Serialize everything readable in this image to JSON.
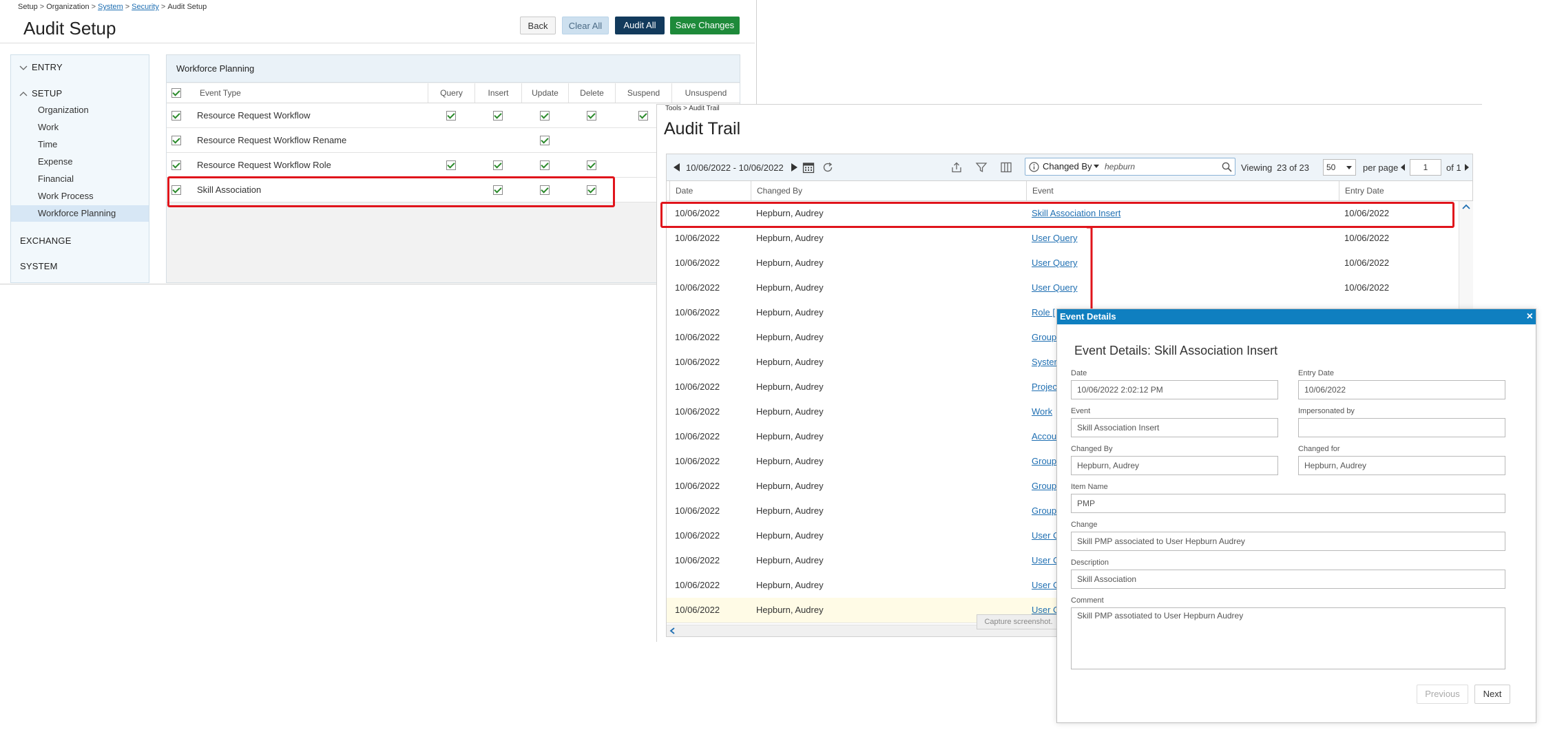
{
  "audit_setup": {
    "breadcrumb": {
      "setup": "Setup",
      "organization": "Organization",
      "system": "System",
      "security": "Security",
      "current": "Audit Setup",
      "sep": ">"
    },
    "title": "Audit Setup",
    "buttons": {
      "back": "Back",
      "clear_all": "Clear All",
      "audit_all": "Audit All",
      "save_changes": "Save Changes"
    },
    "nav": {
      "entry": "ENTRY",
      "setup": "SETUP",
      "setup_items": [
        "Organization",
        "Work",
        "Time",
        "Expense",
        "Financial",
        "Work Process",
        "Workforce Planning"
      ],
      "exchange": "EXCHANGE",
      "system": "SYSTEM"
    },
    "panel_title": "Workforce Planning",
    "columns": [
      "Event Type",
      "Query",
      "Insert",
      "Update",
      "Delete",
      "Suspend",
      "Unsuspend"
    ],
    "rows": [
      {
        "event": "Resource Request Workflow",
        "query": true,
        "insert": true,
        "update": true,
        "delete": true,
        "suspend": true
      },
      {
        "event": "Resource Request Workflow Rename",
        "query": false,
        "insert": false,
        "update": true,
        "delete": false,
        "suspend": false
      },
      {
        "event": "Resource Request Workflow Role",
        "query": true,
        "insert": true,
        "update": true,
        "delete": true,
        "suspend": false
      },
      {
        "event": "Skill Association",
        "query": false,
        "insert": true,
        "update": true,
        "delete": true,
        "suspend": false
      }
    ]
  },
  "audit_trail": {
    "breadcrumb": "Tools > Audit Trail",
    "title": "Audit Trail",
    "date_range": "10/06/2022 - 10/06/2022",
    "filter_field": "Changed By",
    "filter_value": "hepburn",
    "viewing_label": "Viewing",
    "viewing_count": "23 of 23",
    "per_page_value": "50",
    "per_page_label": "per page",
    "page_value": "1",
    "of_label": "of 1",
    "columns": [
      "Date",
      "Changed By",
      "Event",
      "Entry Date"
    ],
    "rows": [
      {
        "date": "10/06/2022",
        "changed_by": "Hepburn, Audrey",
        "event": "Skill Association Insert",
        "entry_date": "10/06/2022"
      },
      {
        "date": "10/06/2022",
        "changed_by": "Hepburn, Audrey",
        "event": "User Query",
        "entry_date": "10/06/2022"
      },
      {
        "date": "10/06/2022",
        "changed_by": "Hepburn, Audrey",
        "event": "User Query",
        "entry_date": "10/06/2022"
      },
      {
        "date": "10/06/2022",
        "changed_by": "Hepburn, Audrey",
        "event": "User Query",
        "entry_date": "10/06/2022"
      },
      {
        "date": "10/06/2022",
        "changed_by": "Hepburn, Audrey",
        "event": "Role [",
        "entry_date": ""
      },
      {
        "date": "10/06/2022",
        "changed_by": "Hepburn, Audrey",
        "event": "Group",
        "entry_date": ""
      },
      {
        "date": "10/06/2022",
        "changed_by": "Hepburn, Audrey",
        "event": "Syster",
        "entry_date": ""
      },
      {
        "date": "10/06/2022",
        "changed_by": "Hepburn, Audrey",
        "event": "Projec",
        "entry_date": ""
      },
      {
        "date": "10/06/2022",
        "changed_by": "Hepburn, Audrey",
        "event": "Work",
        "entry_date": ""
      },
      {
        "date": "10/06/2022",
        "changed_by": "Hepburn, Audrey",
        "event": "Accou",
        "entry_date": ""
      },
      {
        "date": "10/06/2022",
        "changed_by": "Hepburn, Audrey",
        "event": "Group",
        "entry_date": ""
      },
      {
        "date": "10/06/2022",
        "changed_by": "Hepburn, Audrey",
        "event": "Group",
        "entry_date": ""
      },
      {
        "date": "10/06/2022",
        "changed_by": "Hepburn, Audrey",
        "event": "Group",
        "entry_date": ""
      },
      {
        "date": "10/06/2022",
        "changed_by": "Hepburn, Audrey",
        "event": "User C",
        "entry_date": ""
      },
      {
        "date": "10/06/2022",
        "changed_by": "Hepburn, Audrey",
        "event": "User C",
        "entry_date": ""
      },
      {
        "date": "10/06/2022",
        "changed_by": "Hepburn, Audrey",
        "event": "User C",
        "entry_date": ""
      },
      {
        "date": "10/06/2022",
        "changed_by": "Hepburn, Audrey",
        "event": "User C",
        "entry_date": ""
      }
    ],
    "capture_tip": "Capture screenshot."
  },
  "event_details": {
    "window_title": "Event Details",
    "heading": "Event Details: Skill Association Insert",
    "labels": {
      "date": "Date",
      "entry_date": "Entry Date",
      "event": "Event",
      "impersonated_by": "Impersonated by",
      "changed_by": "Changed By",
      "changed_for": "Changed for",
      "item_name": "Item Name",
      "change": "Change",
      "description": "Description",
      "comment": "Comment"
    },
    "values": {
      "date": "10/06/2022 2:02:12 PM",
      "entry_date": "10/06/2022",
      "event": "Skill Association Insert",
      "impersonated_by": "",
      "changed_by": "Hepburn, Audrey",
      "changed_for": "Hepburn, Audrey",
      "item_name": "PMP",
      "change": "Skill PMP associated to User Hepburn Audrey",
      "description": "Skill Association",
      "comment": "Skill PMP assotiated to User Hepburn Audrey"
    },
    "buttons": {
      "previous": "Previous",
      "next": "Next"
    },
    "close_icon": "×"
  },
  "colors": {
    "highlight": "#e0141b",
    "link": "#1f6fb2",
    "save_green": "#1e8a3a",
    "audit_all_navy": "#123a5c",
    "dialog_titlebar": "#0f7fc0"
  }
}
